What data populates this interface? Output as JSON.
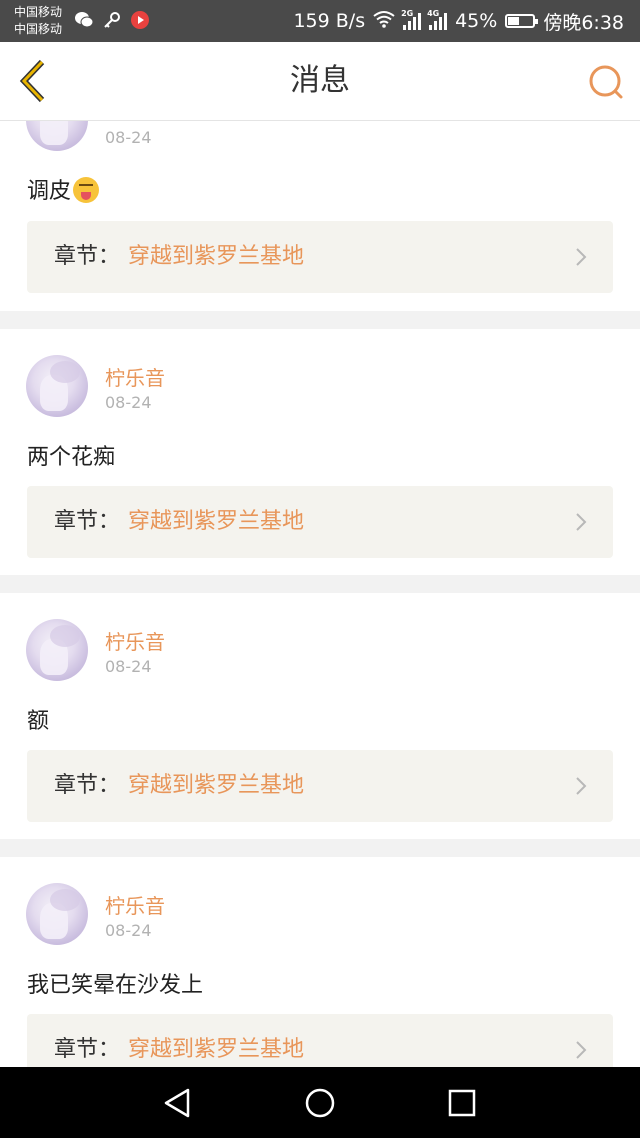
{
  "status_bar": {
    "carrier_1": "中国移动",
    "carrier_2": "中国移动",
    "net_speed": "159 B/s",
    "sig1_label": "2G",
    "sig2_label": "4G",
    "battery": "45%",
    "battery_level": 0.45,
    "time": "傍晚6:38"
  },
  "header": {
    "title": "消息"
  },
  "messages": [
    {
      "user": "",
      "date": "08-24",
      "text": "调皮",
      "chapter_label": "章节：",
      "chapter_title": "穿越到紫罗兰基地"
    },
    {
      "user": "柠乐音",
      "date": "08-24",
      "text": "两个花痴",
      "chapter_label": "章节：",
      "chapter_title": "穿越到紫罗兰基地"
    },
    {
      "user": "柠乐音",
      "date": "08-24",
      "text": "额",
      "chapter_label": "章节：",
      "chapter_title": "穿越到紫罗兰基地"
    },
    {
      "user": "柠乐音",
      "date": "08-24",
      "text": "我已笑晕在沙发上",
      "chapter_label": "章节：",
      "chapter_title": "穿越到紫罗兰基地"
    }
  ],
  "icons": {
    "back": "back-chevron-icon",
    "search": "search-icon",
    "emoji": "tongue-face-emoji-icon",
    "nav_back": "nav-back-icon",
    "nav_home": "nav-home-icon",
    "nav_recents": "nav-recents-icon"
  },
  "colors": {
    "accent": "#e8965a",
    "back_icon": "#e8b400",
    "chapter_bg": "#f4f3ee",
    "status_bar": "#4a4a4a"
  }
}
